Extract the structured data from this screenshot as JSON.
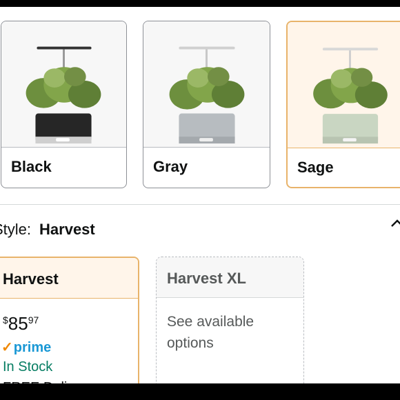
{
  "swatches": [
    {
      "label": "Black",
      "planter_color": "#262626",
      "selected": false
    },
    {
      "label": "Gray",
      "planter_color": "#b7bcc0",
      "selected": false
    },
    {
      "label": "Sage",
      "planter_color": "#c9d6c2",
      "selected": true
    }
  ],
  "style": {
    "key": "Style:",
    "value": "Harvest"
  },
  "options": [
    {
      "title": "Harvest",
      "price": {
        "symbol": "$",
        "whole": "85",
        "fraction": "97"
      },
      "prime_label": "prime",
      "stock": "In Stock",
      "delivery": "FREE Deli"
    },
    {
      "title": "Harvest XL",
      "availability": "See available options"
    }
  ],
  "colors": {
    "accent_border": "#e8b36a",
    "prime_blue": "#1a98d5",
    "stock_green": "#067d62"
  }
}
